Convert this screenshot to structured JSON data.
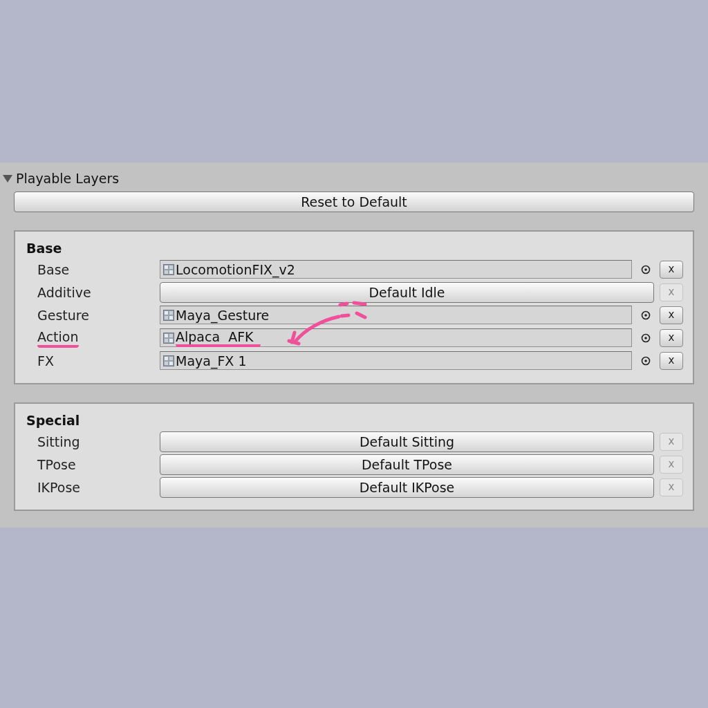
{
  "header": {
    "title": "Playable Layers",
    "expanded": true
  },
  "reset_button": "Reset to Default",
  "sections": [
    {
      "title": "Base",
      "rows": [
        {
          "label": "Base",
          "kind": "asset",
          "value": "LocomotionFIX_v2",
          "annotated": false,
          "clear": "x"
        },
        {
          "label": "Additive",
          "kind": "default",
          "value": "Default Idle",
          "annotated": false,
          "clear": "x"
        },
        {
          "label": "Gesture",
          "kind": "asset",
          "value": "Maya_Gesture",
          "annotated": false,
          "clear": "x"
        },
        {
          "label": "Action",
          "kind": "asset",
          "value": "Alpaca  AFK",
          "annotated": true,
          "clear": "x"
        },
        {
          "label": "FX",
          "kind": "asset",
          "value": "Maya_FX 1",
          "annotated": false,
          "clear": "x"
        }
      ]
    },
    {
      "title": "Special",
      "rows": [
        {
          "label": "Sitting",
          "kind": "default",
          "value": "Default Sitting",
          "annotated": false,
          "clear": "x"
        },
        {
          "label": "TPose",
          "kind": "default",
          "value": "Default TPose",
          "annotated": false,
          "clear": "x"
        },
        {
          "label": "IKPose",
          "kind": "default",
          "value": "Default IKPose",
          "annotated": false,
          "clear": "x"
        }
      ]
    }
  ]
}
